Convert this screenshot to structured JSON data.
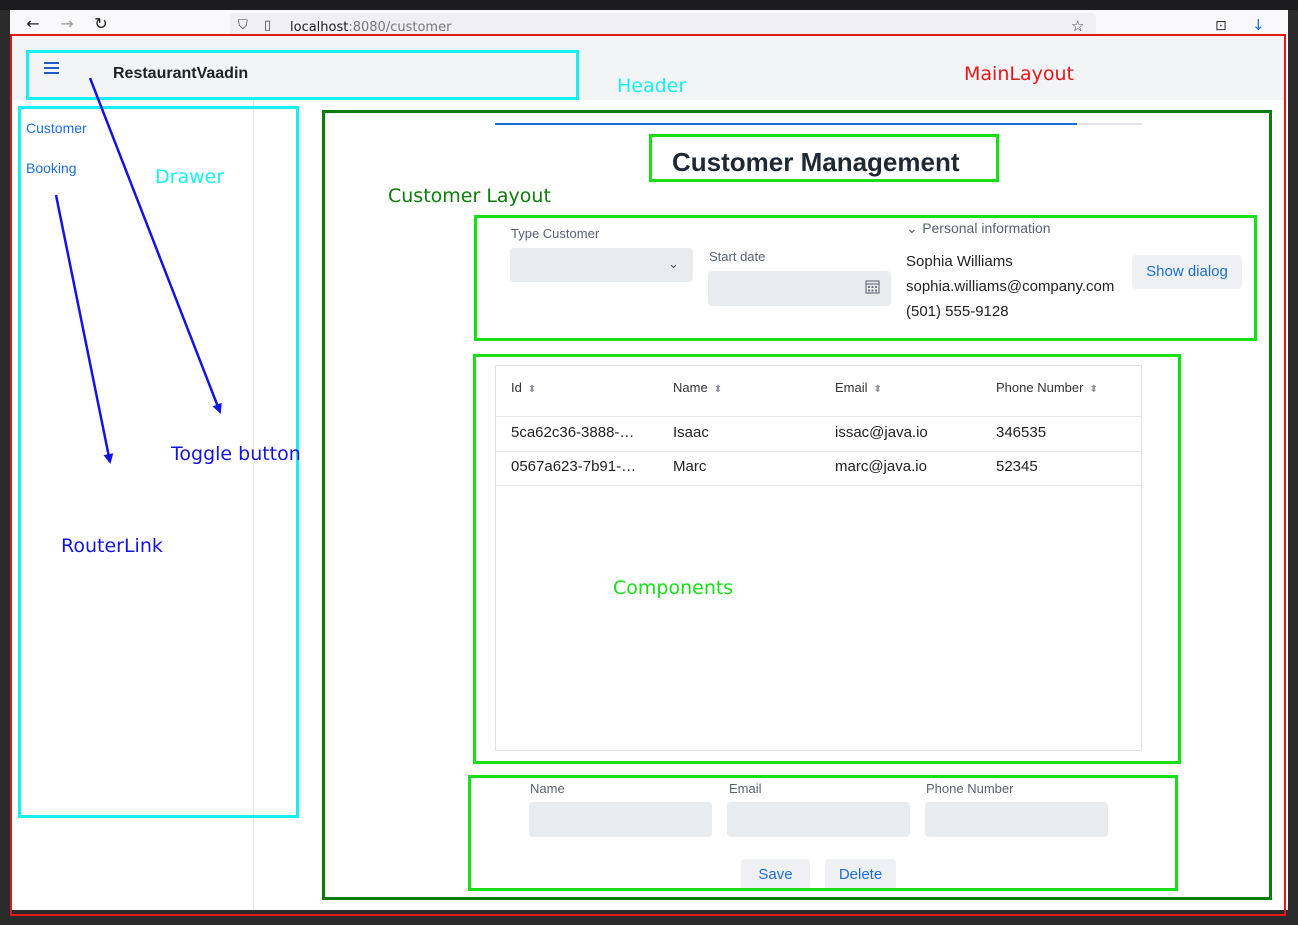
{
  "browser": {
    "url_host": "localhost",
    "url_rest": ":8080/customer"
  },
  "app": {
    "title": "RestaurantVaadin",
    "nav": [
      "Customer",
      "Booking"
    ]
  },
  "page": {
    "title": "Customer Management",
    "type_customer_label": "Type Customer",
    "start_date_label": "Start date",
    "personal_info_summary": "Personal information",
    "person": {
      "name": "Sophia Williams",
      "email": "sophia.williams@company.com",
      "phone": "(501) 555-9128"
    },
    "show_dialog_label": "Show dialog"
  },
  "grid": {
    "columns": [
      "Id",
      "Name",
      "Email",
      "Phone Number"
    ],
    "rows": [
      [
        "5ca62c36-3888-…",
        "Isaac",
        "issac@java.io",
        "346535"
      ],
      [
        "0567a623-7b91-…",
        "Marc",
        "marc@java.io",
        "52345"
      ]
    ]
  },
  "form": {
    "name_label": "Name",
    "email_label": "Email",
    "phone_label": "Phone Number",
    "save_label": "Save",
    "delete_label": "Delete"
  },
  "annotations": {
    "header": "Header",
    "main_layout": "MainLayout",
    "drawer": "Drawer",
    "customer_layout": "Customer Layout",
    "toggle_button": "Toggle button",
    "router_link": "RouterLink",
    "components": "Components"
  },
  "icons": {
    "back": "arrow-left-icon",
    "forward": "arrow-right-icon",
    "reload": "reload-icon",
    "shield": "shield-icon",
    "page": "page-icon",
    "bookmark": "star-icon",
    "pocket": "pocket-icon",
    "download": "download-icon",
    "menu": "hamburger-icon",
    "calendar": "calendar-icon",
    "sort": "sort-icon"
  },
  "colors": {
    "annotation_red": "#e81717",
    "annotation_cyan": "#16f0f2",
    "annotation_lime": "#16e015",
    "annotation_dark_green": "#0b7d0b",
    "annotation_blue": "#1414e0",
    "accent": "#1d6fd6"
  }
}
